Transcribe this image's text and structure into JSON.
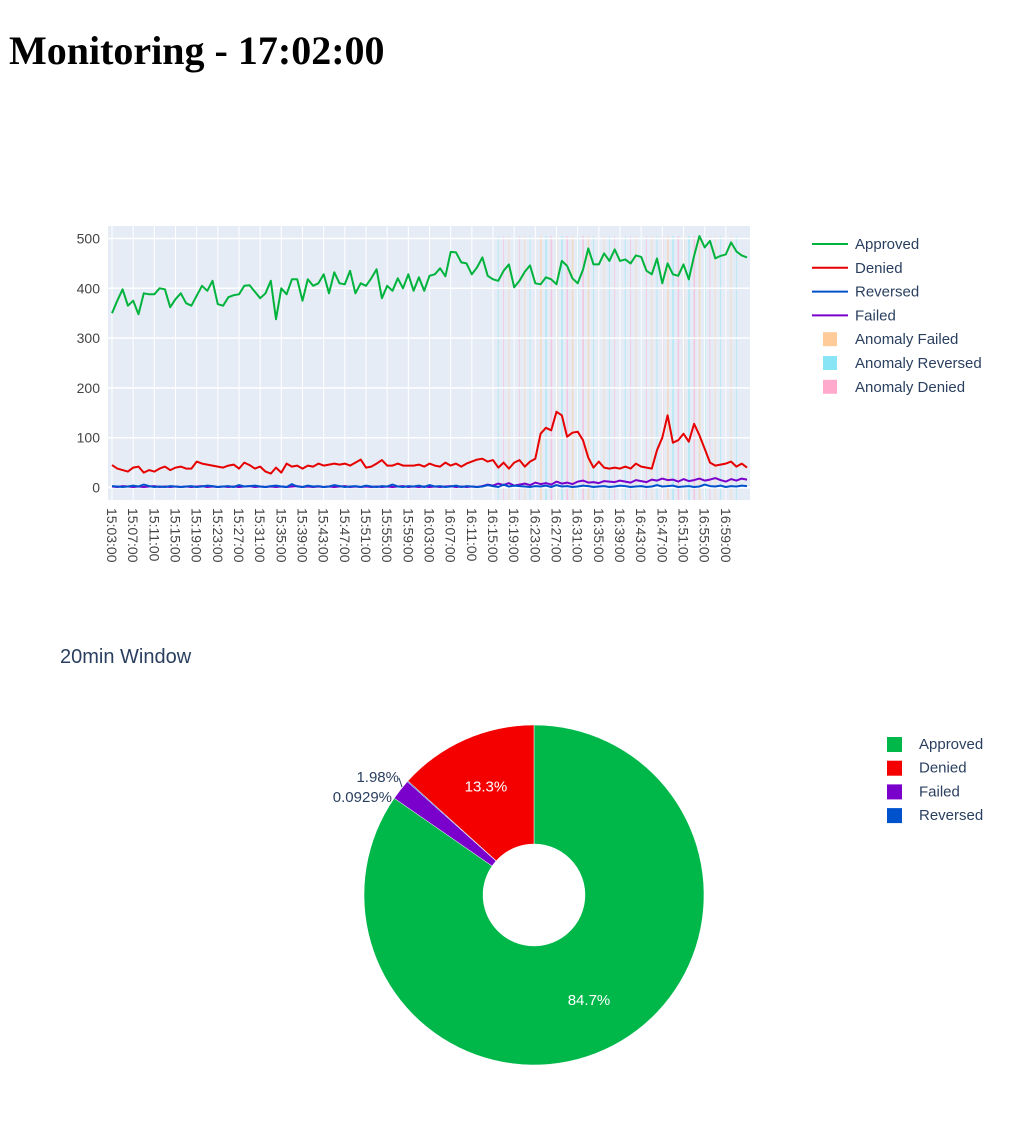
{
  "page": {
    "title": "Monitoring - 17:02:00"
  },
  "chart_data": [
    {
      "type": "line",
      "title": "",
      "xlabel": "",
      "ylabel": "",
      "ylim": [
        -25,
        525
      ],
      "grid": true,
      "legend_placement": "top-right",
      "x_start": "15:03:00",
      "x_step_minutes": 1,
      "x_ticks": [
        "15:03:00",
        "15:07:00",
        "15:11:00",
        "15:15:00",
        "15:19:00",
        "15:23:00",
        "15:27:00",
        "15:31:00",
        "15:35:00",
        "15:39:00",
        "15:43:00",
        "15:47:00",
        "15:51:00",
        "15:55:00",
        "15:59:00",
        "16:03:00",
        "16:07:00",
        "16:11:00",
        "16:15:00",
        "16:19:00",
        "16:23:00",
        "16:27:00",
        "16:31:00",
        "16:35:00",
        "16:39:00",
        "16:43:00",
        "16:47:00",
        "16:51:00",
        "16:55:00",
        "16:59:00"
      ],
      "y_ticks": [
        0,
        100,
        200,
        300,
        400,
        500
      ],
      "series": [
        {
          "name": "Approved",
          "color": "#00b33c",
          "values": [
            350,
            375,
            398,
            365,
            375,
            348,
            390,
            388,
            388,
            400,
            398,
            362,
            378,
            390,
            370,
            365,
            385,
            405,
            395,
            415,
            368,
            365,
            382,
            386,
            388,
            405,
            406,
            393,
            380,
            390,
            415,
            338,
            400,
            388,
            418,
            418,
            375,
            418,
            405,
            410,
            428,
            390,
            432,
            410,
            408,
            435,
            390,
            410,
            405,
            420,
            438,
            380,
            405,
            395,
            420,
            400,
            428,
            395,
            422,
            395,
            425,
            428,
            440,
            424,
            473,
            472,
            452,
            450,
            428,
            442,
            462,
            425,
            418,
            415,
            435,
            448,
            402,
            415,
            433,
            446,
            410,
            408,
            422,
            418,
            408,
            455,
            445,
            420,
            410,
            437,
            480,
            448,
            448,
            470,
            455,
            478,
            455,
            458,
            450,
            466,
            463,
            435,
            428,
            460,
            410,
            450,
            428,
            425,
            448,
            418,
            465,
            505,
            482,
            495,
            460,
            465,
            468,
            492,
            474,
            466,
            462
          ]
        },
        {
          "name": "Denied",
          "color": "#e60000",
          "values": [
            45,
            38,
            35,
            32,
            40,
            42,
            30,
            35,
            32,
            38,
            42,
            35,
            40,
            42,
            38,
            38,
            52,
            48,
            46,
            44,
            42,
            40,
            44,
            46,
            38,
            50,
            45,
            38,
            42,
            32,
            28,
            40,
            30,
            48,
            42,
            44,
            38,
            44,
            42,
            48,
            44,
            46,
            48,
            46,
            48,
            44,
            50,
            56,
            40,
            42,
            48,
            55,
            44,
            44,
            48,
            44,
            44,
            44,
            46,
            42,
            48,
            44,
            42,
            50,
            44,
            48,
            42,
            48,
            52,
            56,
            58,
            52,
            55,
            40,
            50,
            38,
            50,
            55,
            42,
            52,
            58,
            108,
            120,
            115,
            152,
            145,
            102,
            110,
            112,
            95,
            60,
            40,
            52,
            40,
            38,
            40,
            38,
            42,
            38,
            48,
            42,
            40,
            38,
            75,
            100,
            145,
            90,
            95,
            108,
            92,
            128,
            105,
            78,
            50,
            44,
            46,
            48,
            52,
            42,
            48,
            40
          ]
        },
        {
          "name": "Reversed",
          "color": "#0052cc",
          "values": [
            3,
            2,
            1,
            2,
            4,
            2,
            6,
            3,
            1,
            2,
            1,
            3,
            2,
            1,
            2,
            3,
            1,
            2,
            4,
            3,
            1,
            2,
            3,
            1,
            5,
            2,
            3,
            4,
            2,
            1,
            3,
            4,
            2,
            1,
            7,
            2,
            1,
            4,
            2,
            3,
            1,
            2,
            5,
            3,
            1,
            2,
            3,
            1,
            4,
            2,
            1,
            3,
            2,
            6,
            2,
            1,
            3,
            2,
            4,
            1,
            5,
            2,
            3,
            1,
            2,
            4,
            1,
            3,
            2,
            1,
            2,
            5,
            3,
            1,
            6,
            2,
            4,
            3,
            2,
            1,
            3,
            2,
            4,
            1,
            5,
            2,
            3,
            1,
            2,
            4,
            3,
            1,
            2,
            3,
            1,
            2,
            4,
            3,
            1,
            2,
            3,
            1,
            2,
            5,
            2,
            3,
            4,
            1,
            2,
            3,
            1,
            2,
            6,
            3,
            2,
            4,
            1,
            3,
            2,
            4,
            3
          ]
        },
        {
          "name": "Failed",
          "color": "#7a00cc",
          "values": [
            2,
            1,
            3,
            2,
            1,
            2,
            1,
            2,
            3,
            1,
            2,
            1,
            2,
            1,
            2,
            1,
            2,
            3,
            1,
            2,
            1,
            2,
            1,
            2,
            1,
            2,
            3,
            1,
            2,
            1,
            2,
            1,
            2,
            1,
            2,
            3,
            1,
            2,
            1,
            2,
            1,
            2,
            1,
            2,
            3,
            1,
            2,
            1,
            2,
            1,
            2,
            1,
            2,
            1,
            2,
            3,
            1,
            2,
            1,
            2,
            1,
            2,
            1,
            2,
            3,
            1,
            2,
            1,
            2,
            1,
            3,
            6,
            4,
            8,
            5,
            9,
            4,
            6,
            8,
            5,
            10,
            7,
            9,
            6,
            12,
            8,
            10,
            7,
            12,
            14,
            10,
            11,
            9,
            13,
            12,
            11,
            14,
            12,
            10,
            15,
            13,
            11,
            16,
            14,
            18,
            15,
            16,
            12,
            17,
            13,
            15,
            18,
            14,
            16,
            19,
            15,
            12,
            17,
            14,
            18,
            16
          ]
        }
      ],
      "anomaly_legend": [
        {
          "name": "Anomaly Failed",
          "color": "#ffcc99"
        },
        {
          "name": "Anomaly Reversed",
          "color": "#88e5f5"
        },
        {
          "name": "Anomaly Denied",
          "color": "#ffaacc"
        }
      ],
      "anomaly_ranges": [
        {
          "start_index": 72,
          "end_index": 118,
          "dense_ranges": [
            [
              81,
              90
            ],
            [
              104,
              112
            ]
          ]
        }
      ]
    },
    {
      "type": "pie",
      "title": "20min Window",
      "hole": 0.3,
      "legend_placement": "top-right",
      "slices": [
        {
          "label": "Approved",
          "percent": 84.7,
          "text": "84.7%",
          "color": "#00b84a"
        },
        {
          "label": "Denied",
          "percent": 13.3,
          "text": "13.3%",
          "color": "#f50000"
        },
        {
          "label": "Failed",
          "percent": 1.98,
          "text": "1.98%",
          "color": "#7a00cc"
        },
        {
          "label": "Reversed",
          "percent": 0.0929,
          "text": "0.0929%",
          "color": "#0052cc"
        }
      ]
    }
  ]
}
